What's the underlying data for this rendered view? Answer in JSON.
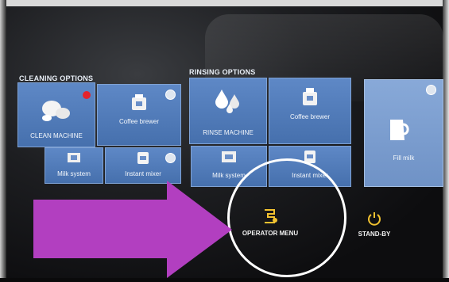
{
  "sections": {
    "cleaning_title": "CLEANING OPTIONS",
    "rinsing_title": "RINSING OPTIONS"
  },
  "cleaning_tiles": [
    {
      "label": "CLEAN MACHINE",
      "icon": "cleaning-tablets-icon",
      "alert": true
    },
    {
      "label": "Coffee brewer",
      "icon": "coffee-brewer-icon"
    },
    {
      "label": "Milk system",
      "icon": "milk-system-icon"
    },
    {
      "label": "Instant mixer",
      "icon": "instant-mixer-icon"
    }
  ],
  "rinsing_tiles": [
    {
      "label": "RINSE MACHINE",
      "icon": "water-drops-icon"
    },
    {
      "label": "Coffee brewer",
      "icon": "coffee-brewer-icon"
    },
    {
      "label": "Milk system",
      "icon": "milk-system-icon"
    },
    {
      "label": "Instant mixer",
      "icon": "instant-mixer-icon"
    }
  ],
  "side_tile": {
    "label": "Fill milk",
    "icon": "milk-jug-icon"
  },
  "bottom": {
    "operator_menu": "OPERATOR MENU",
    "standby": "STAND-BY"
  },
  "annotation": {
    "arrow_color": "#b23fc0",
    "circle_color": "#ffffff"
  },
  "colors": {
    "tile": "#5479b8",
    "tile_light": "#7d9fd2",
    "alert": "#e4232b",
    "accent_icon": "#f2c230"
  }
}
